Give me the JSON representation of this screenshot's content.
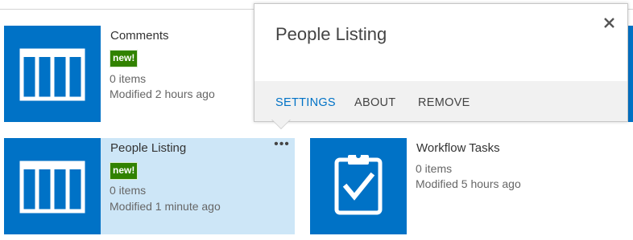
{
  "tiles": [
    {
      "name": "Comments",
      "badge": "new!",
      "items": "0 items",
      "modified": "Modified 2 hours ago",
      "icon": "list-icon"
    },
    {
      "name": "People Listing",
      "badge": "new!",
      "items": "0 items",
      "modified": "Modified 1 minute ago",
      "icon": "list-icon",
      "selected": true,
      "menu": "•••"
    },
    {
      "name": "Workflow Tasks",
      "items": "0 items",
      "modified": "Modified 5 hours ago",
      "icon": "task-clipboard-icon"
    }
  ],
  "callout": {
    "title": "People Listing",
    "close_icon": "close-icon",
    "actions": [
      "SETTINGS",
      "ABOUT",
      "REMOVE"
    ],
    "active_action": "SETTINGS"
  },
  "colors": {
    "tile_blue": "#0072c6",
    "badge_green": "#318200",
    "selected_bg": "#cde6f7",
    "link_blue": "#0072c6",
    "footer_gray": "#f1f1f1"
  }
}
